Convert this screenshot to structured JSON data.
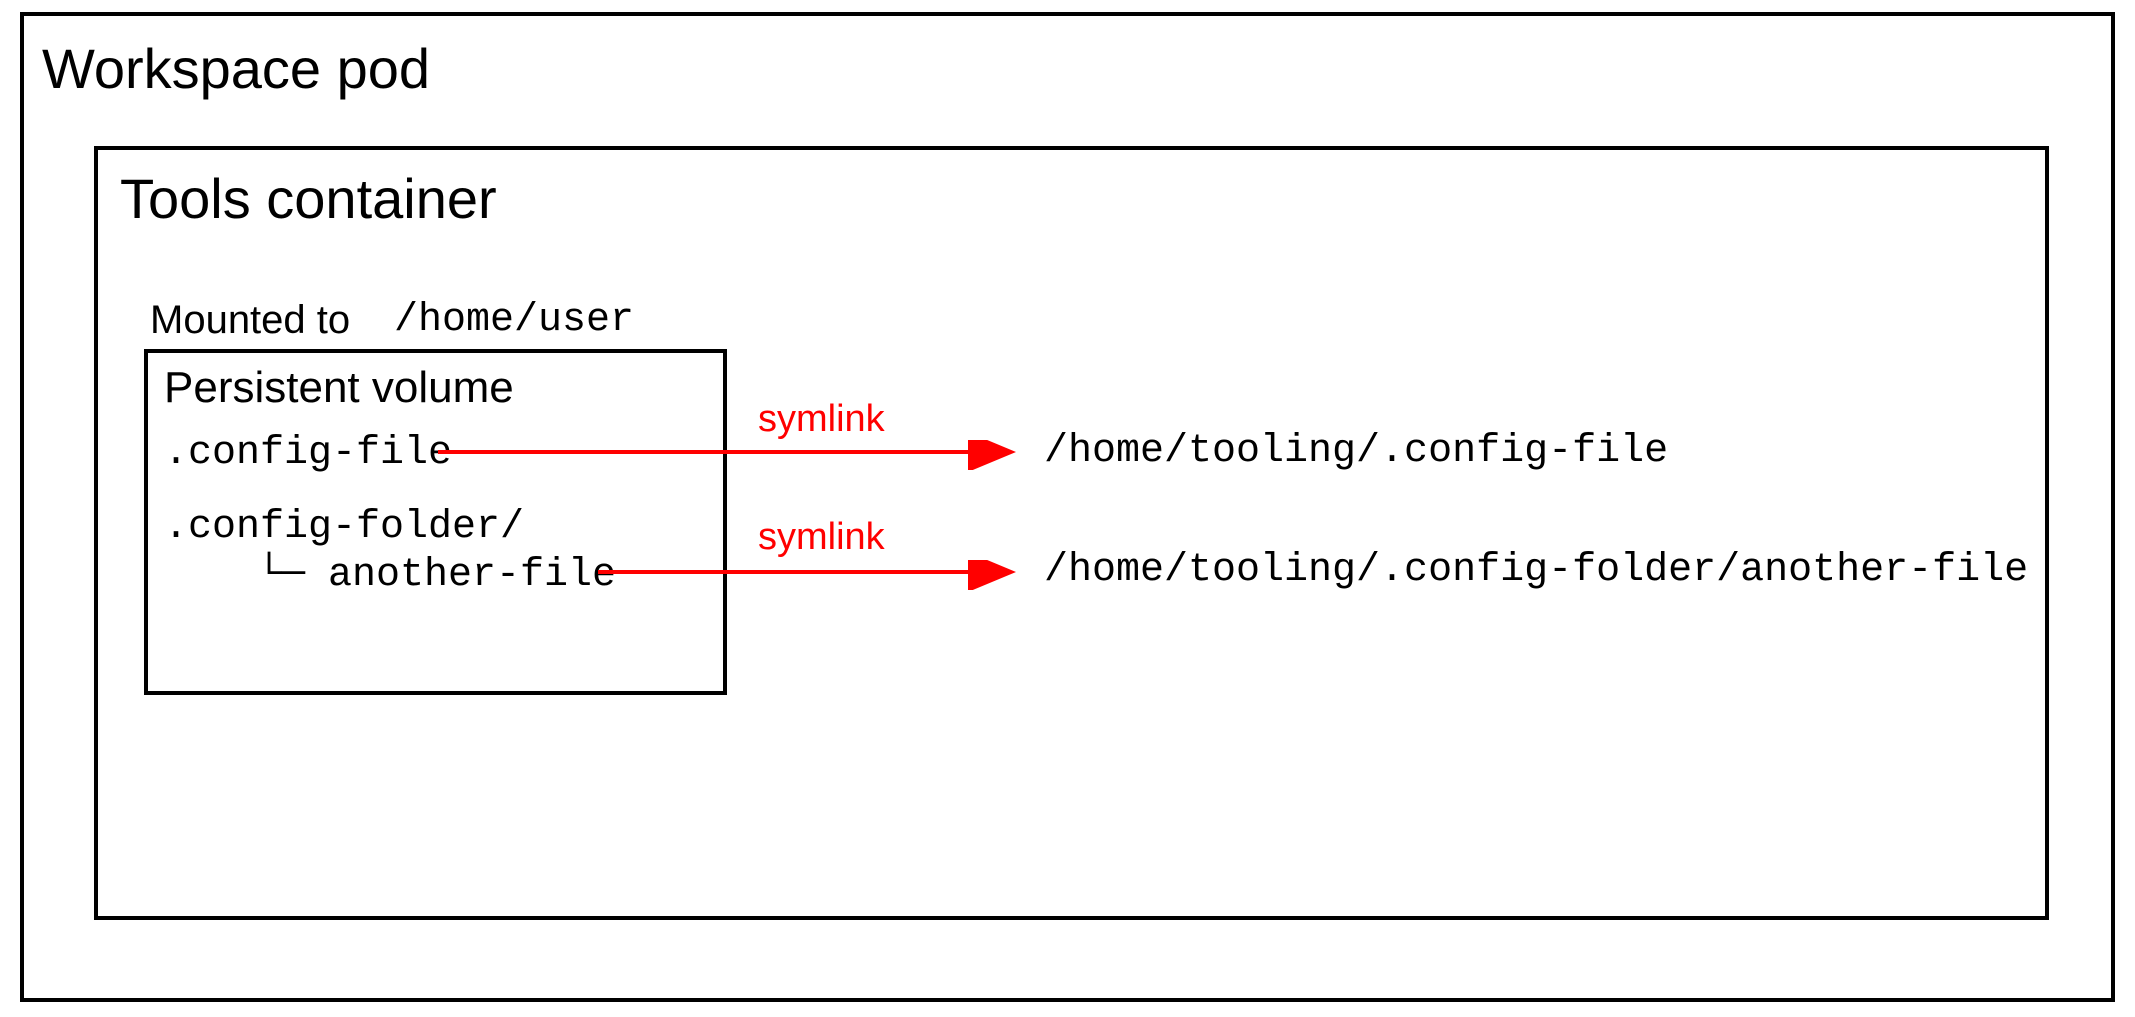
{
  "workspace_pod": {
    "title": "Workspace pod"
  },
  "tools_container": {
    "title": "Tools container",
    "mounted_label": "Mounted to",
    "mounted_path": "/home/user"
  },
  "persistent_volume": {
    "title": "Persistent volume",
    "file1": ".config-file",
    "folder": ".config-folder/",
    "tree_connector": "└─",
    "file2": "another-file"
  },
  "symlinks": {
    "label1": "symlink",
    "label2": "symlink",
    "target1": "/home/tooling/.config-file",
    "target2": "/home/tooling/.config-folder/another-file"
  },
  "colors": {
    "arrow": "#ff0000",
    "border": "#000000"
  }
}
